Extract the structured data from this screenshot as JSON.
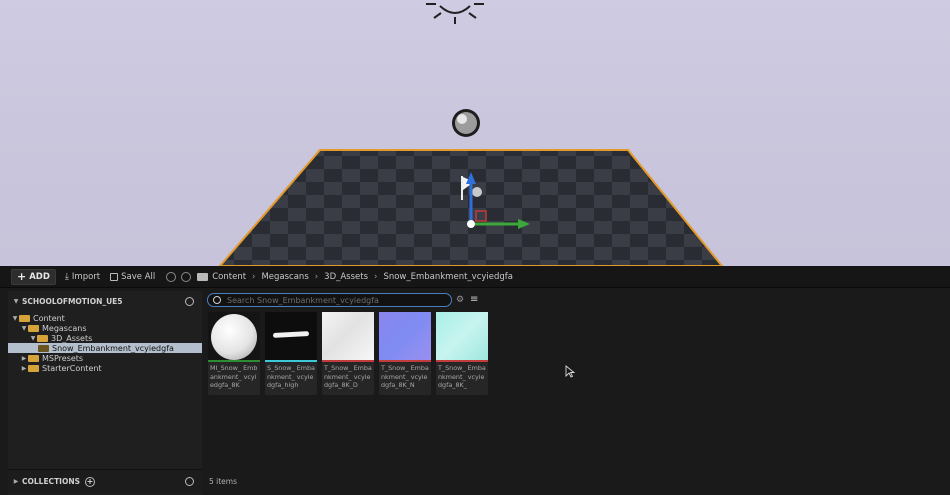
{
  "toolbar": {
    "add_label": "ADD",
    "import_label": "Import",
    "save_all_label": "Save All",
    "breadcrumb": [
      "Content",
      "Megascans",
      "3D_Assets",
      "Snow_Embankment_vcyiedgfa"
    ]
  },
  "sources": {
    "project_label": "SCHOOLOFMOTION_UE5",
    "tree": [
      {
        "label": "Content",
        "depth": 0,
        "expanded": true,
        "selected": false
      },
      {
        "label": "Megascans",
        "depth": 1,
        "expanded": true,
        "selected": false
      },
      {
        "label": "3D_Assets",
        "depth": 2,
        "expanded": true,
        "selected": false
      },
      {
        "label": "Snow_Embankment_vcyiedgfa",
        "depth": 3,
        "expanded": false,
        "selected": true
      },
      {
        "label": "MSPresets",
        "depth": 1,
        "expanded": false,
        "selected": false
      },
      {
        "label": "StarterContent",
        "depth": 1,
        "expanded": false,
        "selected": false
      }
    ],
    "collections_label": "COLLECTIONS"
  },
  "content": {
    "search_placeholder": "Search Snow_Embankment_vcyiedgfa",
    "assets": [
      {
        "label": "MI_Snow_ Embankment_ vcyiedgfa_8K",
        "type_color": "#2f8a36"
      },
      {
        "label": "S_Snow_ Embankment_ vcyiedgfa_high",
        "type_color": "#3ec6d9"
      },
      {
        "label": "T_Snow_ Embankment_ vcyiedgfa_8K_D",
        "type_color": "#c23b3b"
      },
      {
        "label": "T_Snow_ Embankment_ vcyiedgfa_8K_N",
        "type_color": "#c23b3b"
      },
      {
        "label": "T_Snow_ Embankment_ vcyiedgfa_8K_",
        "type_color": "#c23b3b"
      }
    ],
    "item_count": "5 items"
  },
  "icons": [
    "plus-icon",
    "import-icon",
    "save-icon",
    "back-icon",
    "forward-icon",
    "folder-icon",
    "search-icon",
    "filter-icon",
    "settings-icon",
    "add-collection-icon"
  ]
}
